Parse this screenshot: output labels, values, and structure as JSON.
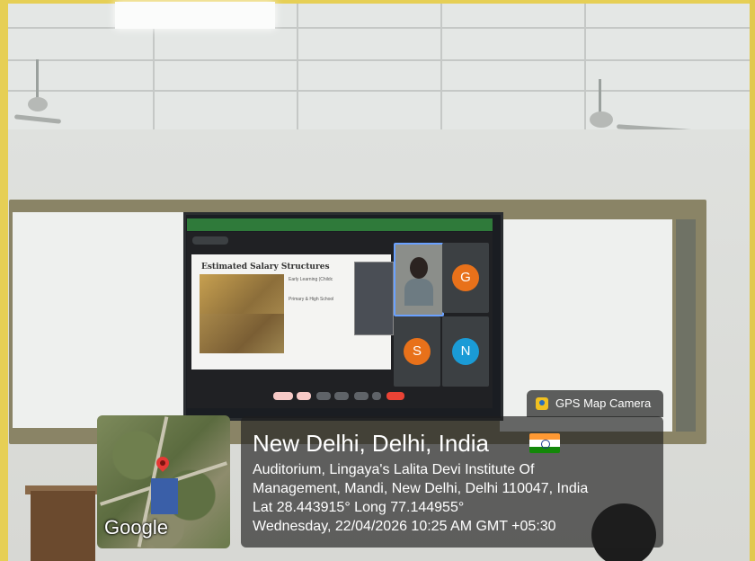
{
  "gps_badge": {
    "label": "GPS Map Camera",
    "icon": "camera-pin-icon"
  },
  "location": {
    "place": "New Delhi, Delhi, India",
    "flag": "india-flag-icon",
    "address_line1": "Auditorium, Lingaya's Lalita Devi Institute Of",
    "address_line2": "Management, Mandi, New Delhi, Delhi 110047, India",
    "coordinates": "Lat 28.443915° Long 77.144955°",
    "datetime": "Wednesday, 22/04/2026 10:25 AM GMT +05:30"
  },
  "map": {
    "logo": "Google"
  },
  "screen": {
    "slide_title": "Estimated Salary Structures",
    "slide_heading_1": "Early Learning (Childc",
    "slide_heading_2": "Primary & High School",
    "participants": [
      {
        "initial": "G",
        "color": "#e8711a"
      },
      {
        "initial": "S",
        "color": "#e8711a"
      },
      {
        "initial": "N",
        "color": "#1a9bd6"
      }
    ]
  },
  "colors": {
    "flag_saffron": "#FF9933",
    "flag_white": "#FFFFFF",
    "flag_green": "#138808",
    "overlay": "rgba(30,30,30,0.66)"
  }
}
